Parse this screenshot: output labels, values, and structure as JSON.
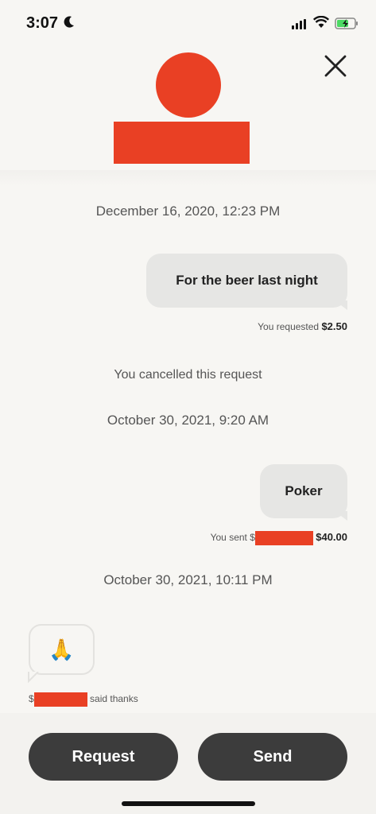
{
  "status": {
    "time": "3:07"
  },
  "thread": {
    "entries": [
      {
        "date": "December 16, 2020, 12:23 PM"
      },
      {
        "bubble": "For the beer last night",
        "meta_prefix": "You requested",
        "amount": "$2.50"
      },
      {
        "note": "You cancelled this request"
      },
      {
        "date": "October 30, 2021, 9:20 AM"
      },
      {
        "bubble": "Poker",
        "meta_prefix": "You sent $",
        "amount": "$40.00"
      },
      {
        "date": "October 30, 2021, 10:11 PM"
      },
      {
        "emoji": "🙏",
        "meta_prefix": "$",
        "meta_suffix": "said thanks"
      }
    ]
  },
  "actions": {
    "request_label": "Request",
    "send_label": "Send"
  },
  "colors": {
    "accent": "#e94024",
    "button": "#3c3c3c",
    "bubble": "#e6e6e4"
  }
}
